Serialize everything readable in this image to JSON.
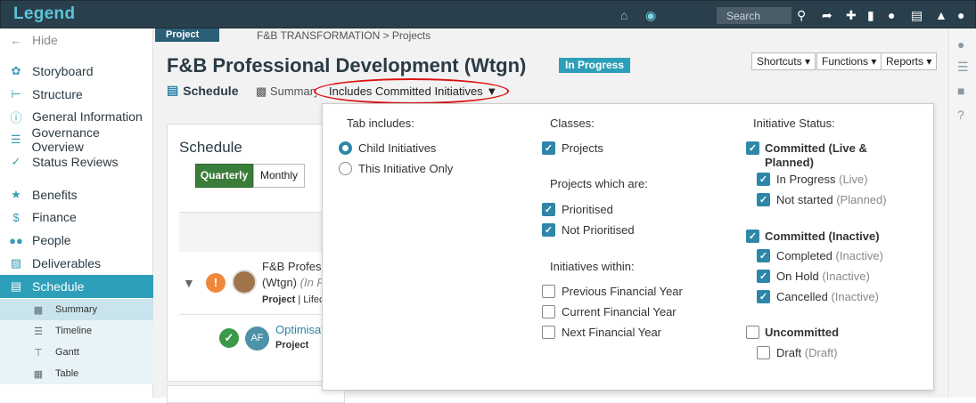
{
  "app": {
    "logo": "Legend",
    "search_placeholder": "Search"
  },
  "sidebar": {
    "hide_label": "Hide",
    "items": [
      {
        "label": "Storyboard",
        "icon": "palette-icon"
      },
      {
        "label": "Structure",
        "icon": "structure-icon"
      },
      {
        "label": "General Information",
        "icon": "info-icon"
      },
      {
        "label": "Governance Overview",
        "icon": "governance-icon"
      },
      {
        "label": "Status Reviews",
        "icon": "check-icon"
      },
      {
        "label": "Benefits",
        "icon": "award-icon"
      },
      {
        "label": "Finance",
        "icon": "dollar-icon"
      },
      {
        "label": "People",
        "icon": "people-icon"
      },
      {
        "label": "Deliverables",
        "icon": "truck-icon"
      },
      {
        "label": "Schedule",
        "icon": "schedule-icon"
      }
    ],
    "subitems": [
      {
        "label": "Summary"
      },
      {
        "label": "Timeline"
      },
      {
        "label": "Gantt"
      },
      {
        "label": "Table"
      }
    ]
  },
  "header": {
    "tag": "Project",
    "breadcrumb": "F&B TRANSFORMATION > Projects",
    "title": "F&B Professional Development (Wtgn)",
    "status": "In Progress",
    "buttons": {
      "shortcuts": "Shortcuts",
      "functions": "Functions",
      "reports": "Reports"
    }
  },
  "tabs": {
    "schedule": "Schedule",
    "summary": "Summary",
    "includes": "Includes Committed Initiatives"
  },
  "card": {
    "title": "Schedule",
    "quarterly": "Quarterly",
    "monthly": "Monthly",
    "row1": {
      "name": "F&B Professional Development",
      "sub": "(Wtgn)",
      "sub_status": "(In Progress)",
      "meta_type": "Project",
      "meta_rest": "| Lifecycle"
    },
    "row2": {
      "avatar": "AF",
      "name": "Optimisation",
      "meta": "Project"
    }
  },
  "dropdown": {
    "tab_includes": {
      "heading": "Tab includes:",
      "options": [
        {
          "label": "Child Initiatives",
          "selected": true
        },
        {
          "label": "This Initiative Only",
          "selected": false
        }
      ]
    },
    "classes": {
      "heading": "Classes:",
      "options": [
        {
          "label": "Projects",
          "checked": true
        }
      ]
    },
    "projects_which": {
      "heading": "Projects which are:",
      "options": [
        {
          "label": "Prioritised",
          "checked": true
        },
        {
          "label": "Not Prioritised",
          "checked": true
        }
      ]
    },
    "initiatives_within": {
      "heading": "Initiatives within:",
      "options": [
        {
          "label": "Previous Financial Year",
          "checked": false
        },
        {
          "label": "Current Financial Year",
          "checked": false
        },
        {
          "label": "Next Financial Year",
          "checked": false
        }
      ]
    },
    "status": {
      "heading": "Initiative Status:",
      "committed_live": {
        "label_line1": "Committed (Live &",
        "label_line2": "Planned)",
        "checked": true
      },
      "in_progress": {
        "label": "In Progress",
        "note": "(Live)",
        "checked": true
      },
      "not_started": {
        "label": "Not started",
        "note": "(Planned)",
        "checked": true
      },
      "committed_inactive": {
        "label": "Committed (Inactive)",
        "checked": true
      },
      "completed": {
        "label": "Completed",
        "note": "(Inactive)",
        "checked": true
      },
      "on_hold": {
        "label": "On Hold",
        "note": "(Inactive)",
        "checked": true
      },
      "cancelled": {
        "label": "Cancelled",
        "note": "(Inactive)",
        "checked": true
      },
      "uncommitted": {
        "label": "Uncommitted",
        "checked": false
      },
      "draft": {
        "label": "Draft",
        "note": "(Draft)",
        "checked": false
      }
    }
  },
  "colors": {
    "topbar": "#293f4c",
    "accent": "#2e9fb8",
    "green": "#3a7d3a",
    "highlight": "#dd1111"
  }
}
